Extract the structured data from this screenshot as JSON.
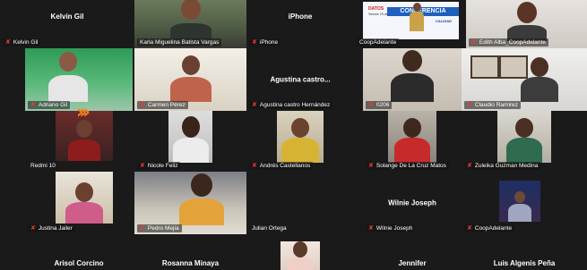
{
  "meeting": {
    "arrows_glyph": "›››",
    "mic_icon_glyph": "✘",
    "tiles": [
      {
        "name_label": "Kelvin Gil",
        "top_name": "Kelvin Gil"
      },
      {
        "name_label": "Karla Miguelina Batista Vargas"
      },
      {
        "name_label": "iPhone",
        "top_name": "iPhone"
      },
      {
        "name_label": "CoopAdelante",
        "poster": {
          "title": "DATOS",
          "subtitle": "Viernes 25 de enero",
          "band": "CONFERENCIA",
          "sub": "CALIDAD"
        }
      },
      {
        "name_label": "Edith Alba_CoopAdelante"
      },
      {
        "name_label": "Adriano Gil"
      },
      {
        "name_label": "Carmen Pérez"
      },
      {
        "name_label": "Agustina castro Hernández",
        "center_name": "Agustina castro..."
      },
      {
        "name_label": "0206"
      },
      {
        "name_label": "Claudio Ramirez"
      },
      {
        "name_label": "Redmi 10"
      },
      {
        "name_label": "Nicole Feliz"
      },
      {
        "name_label": "Andrés Castellanos"
      },
      {
        "name_label": "Solange De La Cruz Matos"
      },
      {
        "name_label": "Zuleika Guzman Medina"
      },
      {
        "name_label": "Justina Jailer"
      },
      {
        "name_label": "Pedro Mejia"
      },
      {
        "name_label": "Julian Ortega"
      },
      {
        "name_label": "Wilnie Joseph",
        "center_name": "Wilnie Joseph"
      },
      {
        "name_label": "CoopAdelante"
      },
      {
        "top_name": "Arisol Corcino"
      },
      {
        "top_name": "Rosanna Minaya"
      },
      {
        "name_label": ""
      },
      {
        "top_name": "Jennifer"
      },
      {
        "top_name": "Luis Algenis Peña"
      }
    ]
  },
  "colors": {
    "background": "#1a1a1a",
    "active_speaker_border": "#2fbf4f",
    "muted_mic": "#e53935",
    "arrow_overlay": "#f57c1f"
  }
}
